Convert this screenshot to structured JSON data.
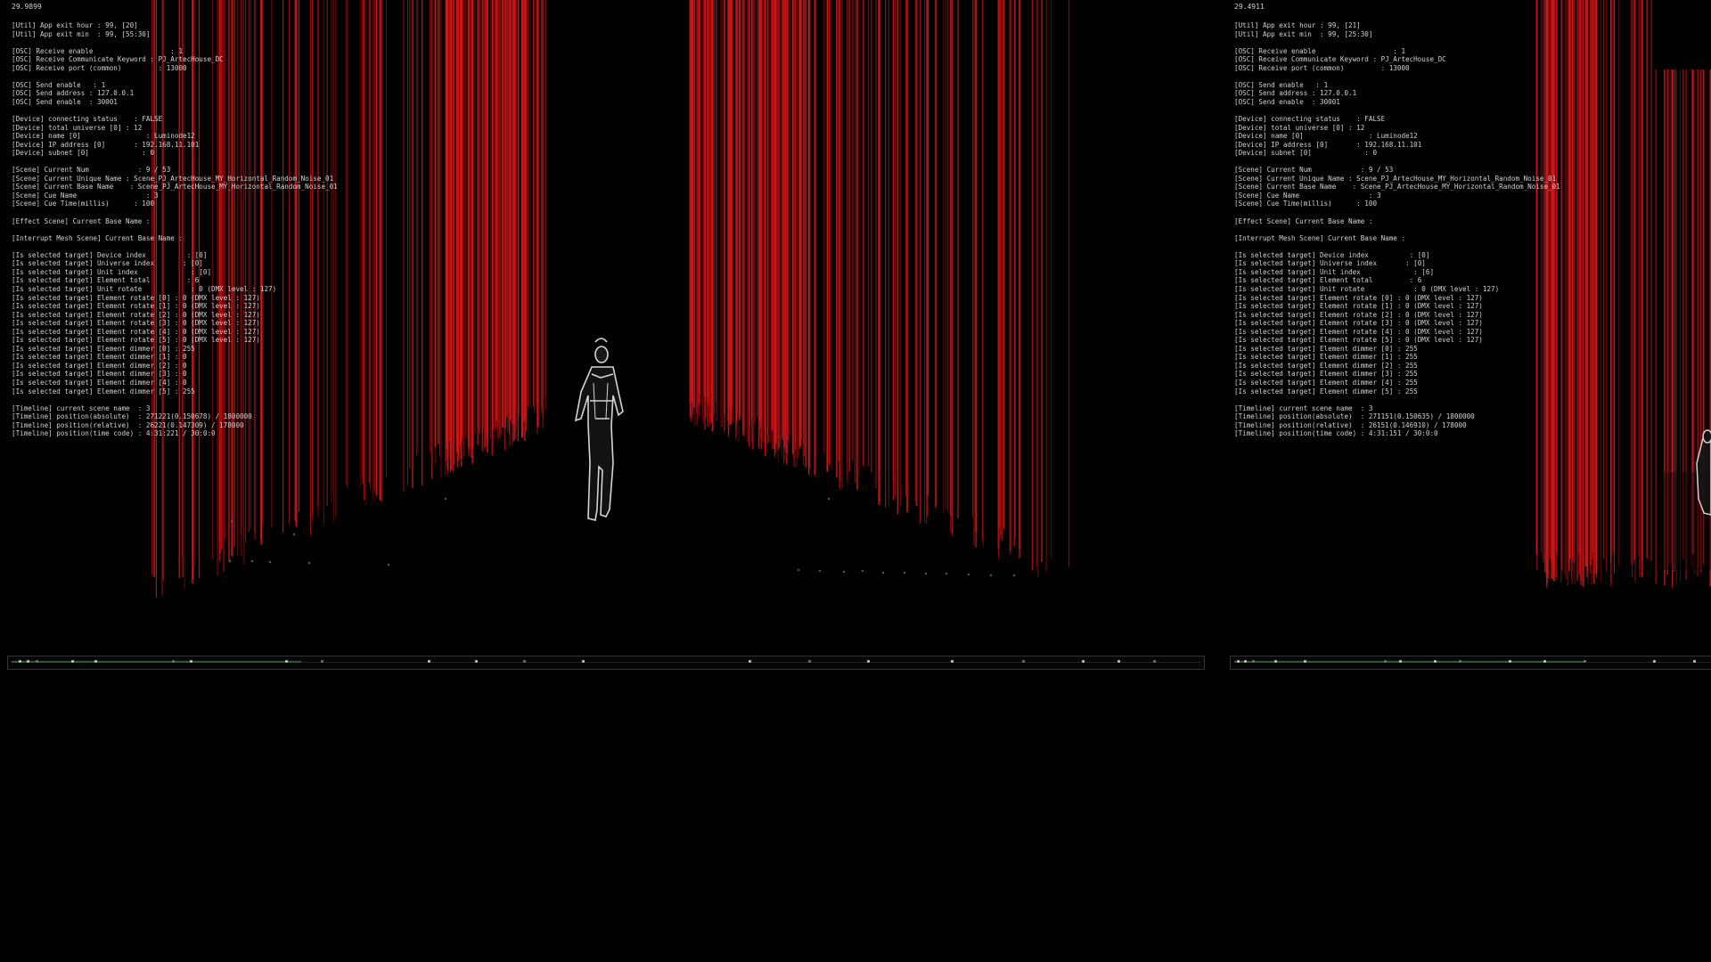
{
  "panels": [
    {
      "fps": "29.9899",
      "debug_lines": [
        "[Util] App exit hour : 99, [20]",
        "[Util] App exit min  : 99, [55:30]",
        "",
        "[OSC] Receive enable                   : 1",
        "[OSC] Receive Communicate Keyword : PJ_ArtecHouse_DC",
        "[OSC] Receive port (common)         : 13000",
        "",
        "[OSC] Send enable   : 1",
        "[OSC] Send address : 127.0.0.1",
        "[OSC] Send enable  : 30001",
        "",
        "[Device] connecting status    : FALSE",
        "[Device] total universe [0] : 12",
        "[Device] name [0]                : Luminode12",
        "[Device] IP address [0]       : 192.168.11.101",
        "[Device] subnet [0]             : 0",
        "",
        "[Scene] Current Num            : 9 / 53",
        "[Scene] Current Unique Name : Scene_PJ_ArtecHouse_MY_Horizontal_Random_Noise_01",
        "[Scene] Current Base Name    : Scene_PJ_ArtecHouse_MY_Horizontal_Random_Noise_01",
        "[Scene] Cue Name                 : 3",
        "[Scene] Cue Time(millis)      : 100",
        "",
        "[Effect Scene] Current Base Name :",
        "",
        "[Interrupt Mesh Scene] Current Base Name :",
        "",
        "[Is selected target] Device index          : [0]",
        "[Is selected target] Universe index       : [0]",
        "[Is selected target] Unit index             : [0]",
        "[Is selected target] Element total         : 6",
        "[Is selected target] Unit rotate            : 0 (DMX level : 127)",
        "[Is selected target] Element rotate [0] : 0 (DMX level : 127)",
        "[Is selected target] Element rotate [1] : 0 (DMX level : 127)",
        "[Is selected target] Element rotate [2] : 0 (DMX level : 127)",
        "[Is selected target] Element rotate [3] : 0 (DMX level : 127)",
        "[Is selected target] Element rotate [4] : 0 (DMX level : 127)",
        "[Is selected target] Element rotate [5] : 0 (DMX level : 127)",
        "[Is selected target] Element dimmer [0] : 255",
        "[Is selected target] Element dimmer [1] : 0",
        "[Is selected target] Element dimmer [2] : 0",
        "[Is selected target] Element dimmer [3] : 0",
        "[Is selected target] Element dimmer [4] : 0",
        "[Is selected target] Element dimmer [5] : 255",
        "",
        "[Timeline] current scene name  : 3",
        "[Timeline] position(absolute)  : 271221(0.150678) / 1800000",
        "[Timeline] position(relative)  : 26221(0.147309) / 178000",
        "[Timeline] position(time code) : 4:31:221 / 30:0:0"
      ],
      "timeline_progress": 0.244
    },
    {
      "fps": "29.4911",
      "debug_lines": [
        "[Util] App exit hour : 99, [21]",
        "[Util] App exit min  : 99, [25:30]",
        "",
        "[OSC] Receive enable                   : 1",
        "[OSC] Receive Communicate Keyword : PJ_ArtecHouse_DC",
        "[OSC] Receive port (common)         : 13000",
        "",
        "[OSC] Send enable   : 1",
        "[OSC] Send address : 127.0.0.1",
        "[OSC] Send enable  : 30001",
        "",
        "[Device] connecting status    : FALSE",
        "[Device] total universe [0] : 12",
        "[Device] name [0]                : Luminode12",
        "[Device] IP address [0]       : 192.168.11.101",
        "[Device] subnet [0]             : 0",
        "",
        "[Scene] Current Num            : 9 / 53",
        "[Scene] Current Unique Name : Scene_PJ_ArtecHouse_MY_Horizontal_Random_Noise_01",
        "[Scene] Current Base Name    : Scene_PJ_ArtecHouse_MY_Horizontal_Random_Noise_01",
        "[Scene] Cue Name                 : 3",
        "[Scene] Cue Time(millis)      : 100",
        "",
        "[Effect Scene] Current Base Name :",
        "",
        "[Interrupt Mesh Scene] Current Base Name :",
        "",
        "[Is selected target] Device index          : [0]",
        "[Is selected target] Universe index       : [0]",
        "[Is selected target] Unit index             : [6]",
        "[Is selected target] Element total         : 6",
        "[Is selected target] Unit rotate            : 0 (DMX level : 127)",
        "[Is selected target] Element rotate [0] : 0 (DMX level : 127)",
        "[Is selected target] Element rotate [1] : 0 (DMX level : 127)",
        "[Is selected target] Element rotate [2] : 0 (DMX level : 127)",
        "[Is selected target] Element rotate [3] : 0 (DMX level : 127)",
        "[Is selected target] Element rotate [4] : 0 (DMX level : 127)",
        "[Is selected target] Element rotate [5] : 0 (DMX level : 127)",
        "[Is selected target] Element dimmer [0] : 255",
        "[Is selected target] Element dimmer [1] : 255",
        "[Is selected target] Element dimmer [2] : 255",
        "[Is selected target] Element dimmer [3] : 255",
        "[Is selected target] Element dimmer [4] : 255",
        "[Is selected target] Element dimmer [5] : 255",
        "",
        "[Timeline] current scene name  : 3",
        "[Timeline] position(absolute)  : 271151(0.150635) / 1800000",
        "[Timeline] position(relative)  : 26151(0.146910) / 178000",
        "[Timeline] position(time code) : 4:31:151 / 30:0:0"
      ],
      "timeline_progress": 0.7
    }
  ],
  "colors": {
    "background": "#000000",
    "curtain_red": "#d01818",
    "text": "#d2d2d2",
    "timeline_progress": "#2f5a38"
  }
}
